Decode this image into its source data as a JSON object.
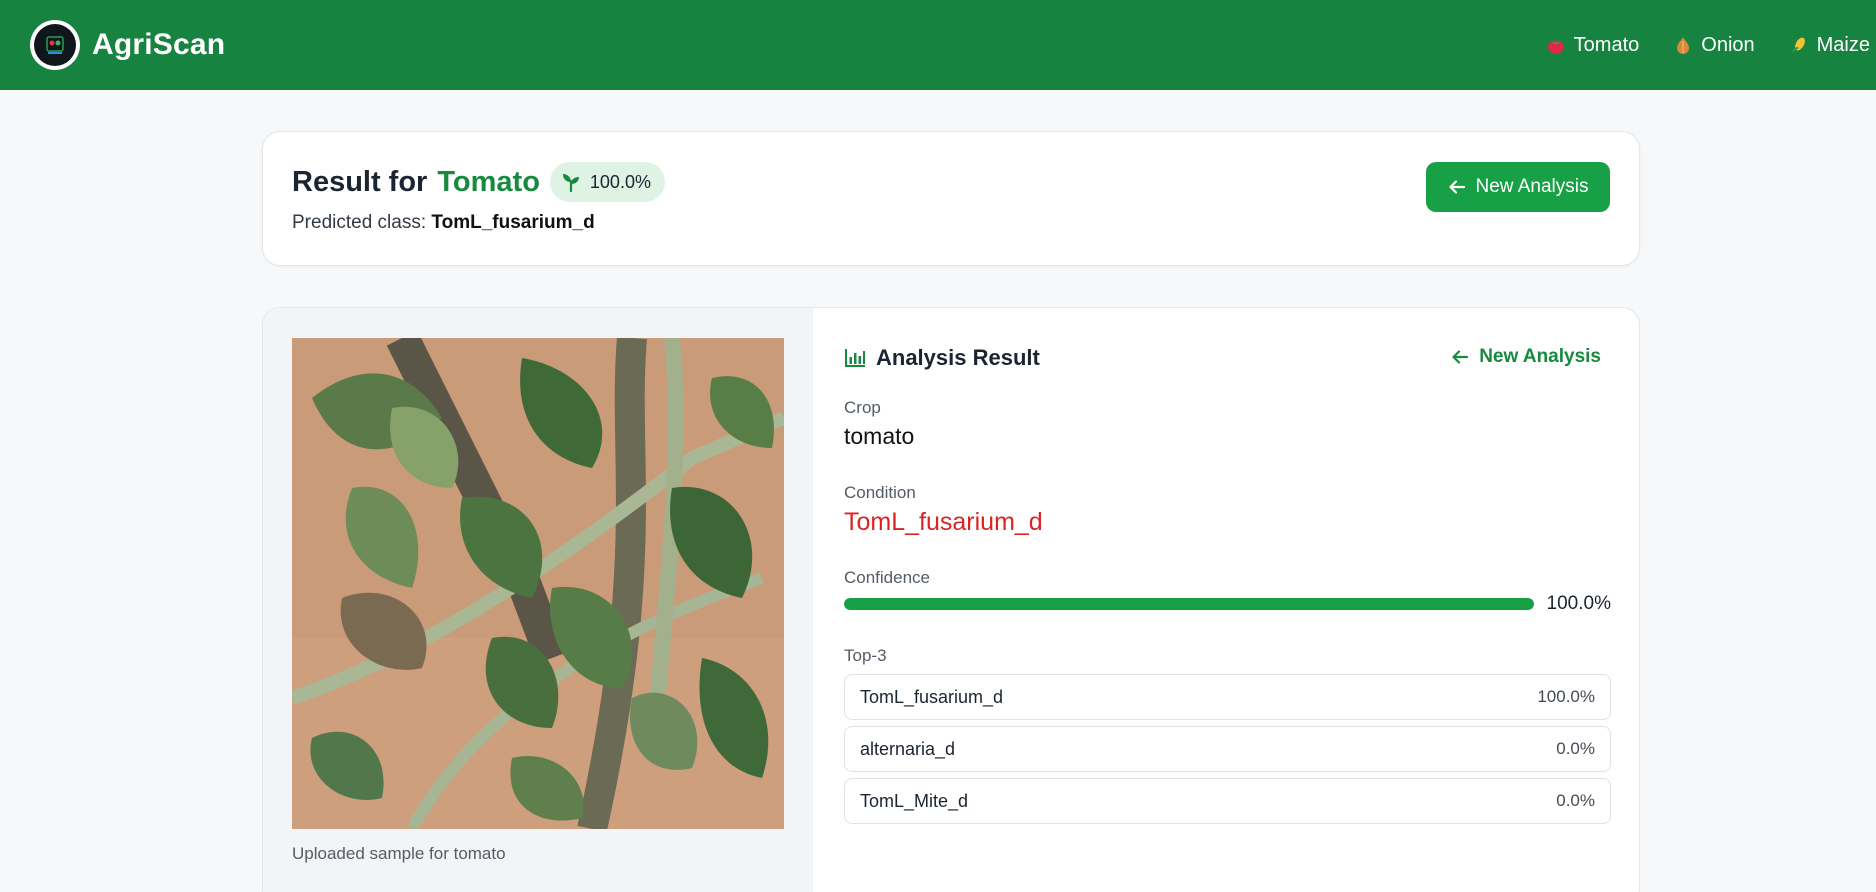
{
  "header": {
    "brand": "AgriScan",
    "logo_icon": "leaf-health-logo-icon",
    "nav": [
      {
        "label": "Tomato",
        "icon": "tomato-icon"
      },
      {
        "label": "Onion",
        "icon": "onion-icon"
      },
      {
        "label": "Maize",
        "icon": "maize-icon"
      }
    ],
    "colors": {
      "header_bg": "#178340"
    }
  },
  "summary": {
    "title_prefix": "Result for",
    "crop": "Tomato",
    "confidence_badge": "100.0%",
    "badge_icon": "sprout-icon",
    "predicted_label": "Predicted class:",
    "predicted_class": "TomL_fusarium_d",
    "new_analysis_button": "New Analysis",
    "button_icon": "arrow-left-icon"
  },
  "sample": {
    "caption": "Uploaded sample for tomato"
  },
  "analysis": {
    "header_icon": "bar-chart-icon",
    "title": "Analysis Result",
    "new_analysis_link": "New Analysis",
    "crop_label": "Crop",
    "crop_value": "tomato",
    "condition_label": "Condition",
    "condition_value": "TomL_fusarium_d",
    "confidence_label": "Confidence",
    "confidence_value": "100.0%",
    "confidence_fraction": 1.0,
    "top3_label": "Top-3",
    "top3": [
      {
        "name": "TomL_fusarium_d",
        "pct": "100.0%"
      },
      {
        "name": "alternaria_d",
        "pct": "0.0%"
      },
      {
        "name": "TomL_Mite_d",
        "pct": "0.0%"
      }
    ],
    "colors": {
      "accent": "#17a045",
      "condition": "#dc2323"
    }
  }
}
